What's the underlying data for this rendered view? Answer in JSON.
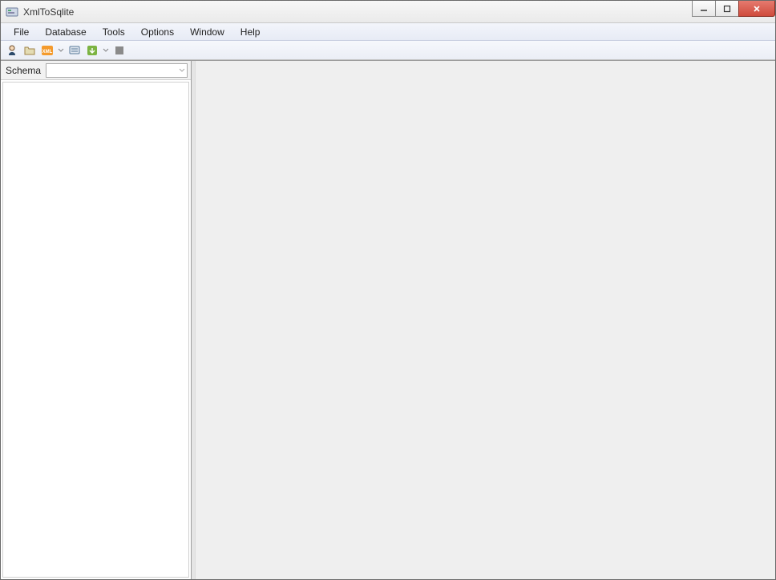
{
  "window": {
    "title": "XmlToSqlite"
  },
  "menu": {
    "items": [
      {
        "label": "File"
      },
      {
        "label": "Database"
      },
      {
        "label": "Tools"
      },
      {
        "label": "Options"
      },
      {
        "label": "Window"
      },
      {
        "label": "Help"
      }
    ]
  },
  "toolbar": {
    "icons": [
      {
        "name": "connect-icon"
      },
      {
        "name": "open-file-icon"
      },
      {
        "name": "xml-icon"
      },
      {
        "name": "query-icon"
      },
      {
        "name": "export-icon"
      },
      {
        "name": "stop-icon"
      }
    ]
  },
  "sidebar": {
    "schema_label": "Schema",
    "schema_value": ""
  }
}
